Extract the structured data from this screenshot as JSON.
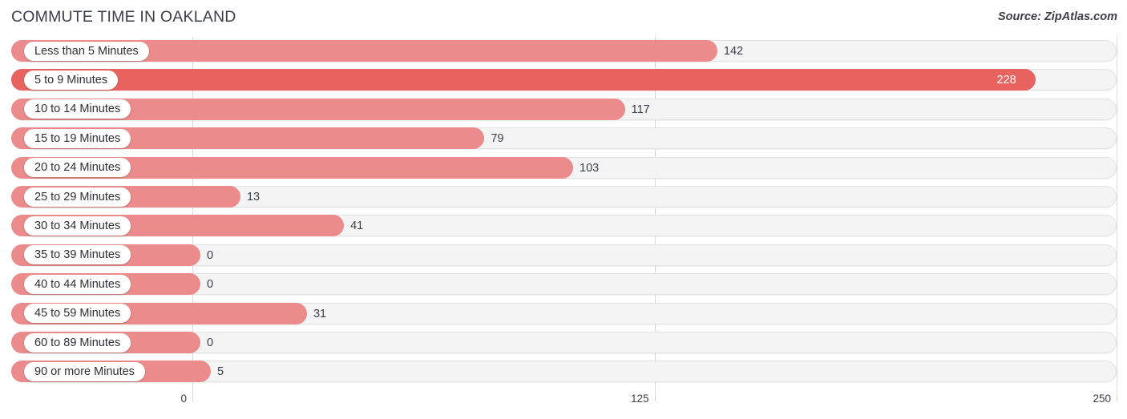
{
  "header": {
    "title": "COMMUTE TIME IN OAKLAND",
    "source": "Source: ZipAtlas.com"
  },
  "colors": {
    "bar": "#ec8b8b",
    "bar_highlight": "#e8625f",
    "track": "#f4f4f4",
    "text": "#3b3f4a",
    "gridline": "#d9d9d9"
  },
  "chart_data": {
    "type": "bar",
    "orientation": "horizontal",
    "title": "COMMUTE TIME IN OAKLAND",
    "xlabel": "",
    "ylabel": "",
    "xlim": [
      0,
      250
    ],
    "ticks": [
      "0",
      "125",
      "250"
    ],
    "tick_values": [
      0,
      125,
      250
    ],
    "grid": true,
    "legend": "none",
    "categories": [
      "Less than 5 Minutes",
      "5 to 9 Minutes",
      "10 to 14 Minutes",
      "15 to 19 Minutes",
      "20 to 24 Minutes",
      "25 to 29 Minutes",
      "30 to 34 Minutes",
      "35 to 39 Minutes",
      "40 to 44 Minutes",
      "45 to 59 Minutes",
      "60 to 89 Minutes",
      "90 or more Minutes"
    ],
    "values": [
      142,
      228,
      117,
      79,
      103,
      13,
      41,
      0,
      0,
      31,
      0,
      5
    ],
    "value_labels": [
      "142",
      "228",
      "117",
      "79",
      "103",
      "13",
      "41",
      "0",
      "0",
      "31",
      "0",
      "5"
    ]
  }
}
